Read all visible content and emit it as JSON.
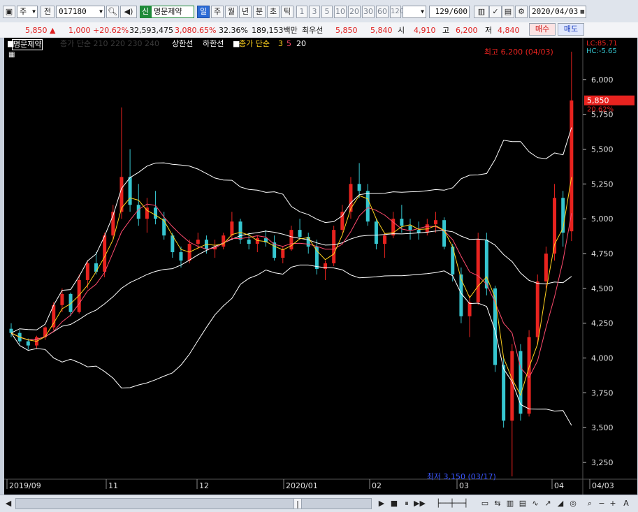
{
  "toolbar": {
    "period_select": "주",
    "prev_label": "전",
    "stock_code": "017180",
    "stock_badge": "신",
    "stock_name": "명문제약",
    "periods": [
      "일",
      "주",
      "월",
      "년",
      "분",
      "초",
      "틱"
    ],
    "active_period": "일",
    "interval_buttons": [
      "1",
      "3",
      "5",
      "10",
      "20",
      "30",
      "60",
      "120"
    ],
    "count_value": "129",
    "count_total": "/600",
    "date_value": "2020/04/03"
  },
  "quote": {
    "price": "5,850",
    "change_arrow": "▲",
    "change": "1,000",
    "change_pct": "+20.62%",
    "volume": "32,593,475",
    "volume_ratio": "3,080.65%",
    "turnover": "32.36%",
    "amount": "189,153백만",
    "best_ask_label": "최우선",
    "best_ask": "5,850",
    "best_bid": "5,840",
    "open_label": "시",
    "open": "4,910",
    "high_label": "고",
    "high": "6,200",
    "low_label": "저",
    "low": "4,840",
    "buy_label": "매수",
    "sell_label": "매도"
  },
  "chart_legend": {
    "name": "명문제약",
    "dim_text": "종가 단순 210 220 230 240",
    "upper_limit": "상한선",
    "lower_limit": "하한선",
    "ma_label": "종가 단순",
    "ma3": "3",
    "ma5": "5",
    "ma20": "20",
    "lc": "LC:85.71",
    "hc": "HC:-5.65"
  },
  "annotations": {
    "high_note": "최고 6,200 (04/03)",
    "low_note": "최저 3,150 (03/17)",
    "last_price": "5,850",
    "last_pct": "20.62%"
  },
  "colors": {
    "up": "#e8231f",
    "down": "#36c6d0",
    "ma3": "#ffd21f",
    "ma5": "#ff4b6e",
    "band": "#ffffff",
    "accent": "#2c6bd6"
  },
  "chart_data": {
    "type": "candlestick",
    "y_ticks": [
      "6,000",
      "5,750",
      "5,500",
      "5,250",
      "5,000",
      "4,750",
      "4,500",
      "4,250",
      "4,000",
      "3,750",
      "3,500",
      "3,250"
    ],
    "x_labels": [
      "2019/09",
      "11",
      "12",
      "2020/01",
      "02",
      "03",
      "04",
      "04/03"
    ],
    "ylim": [
      3150,
      6250
    ],
    "candles": [
      [
        4210,
        4250,
        4150,
        4180
      ],
      [
        4180,
        4200,
        4100,
        4120
      ],
      [
        4120,
        4140,
        4060,
        4090
      ],
      [
        4090,
        4160,
        4070,
        4150
      ],
      [
        4150,
        4230,
        4130,
        4220
      ],
      [
        4220,
        4400,
        4200,
        4380
      ],
      [
        4380,
        4500,
        4330,
        4460
      ],
      [
        4460,
        4470,
        4300,
        4330
      ],
      [
        4330,
        4600,
        4320,
        4560
      ],
      [
        4560,
        4700,
        4500,
        4680
      ],
      [
        4680,
        4760,
        4600,
        4620
      ],
      [
        4620,
        4900,
        4580,
        4880
      ],
      [
        4880,
        5100,
        4850,
        5050
      ],
      [
        5050,
        5800,
        5000,
        5300
      ],
      [
        5300,
        5500,
        5050,
        5100
      ],
      [
        5100,
        5250,
        4950,
        5000
      ],
      [
        5000,
        5150,
        4900,
        5080
      ],
      [
        5080,
        5200,
        4960,
        5000
      ],
      [
        5000,
        5050,
        4850,
        4880
      ],
      [
        4880,
        4900,
        4720,
        4760
      ],
      [
        4760,
        4800,
        4650,
        4700
      ],
      [
        4700,
        4850,
        4680,
        4820
      ],
      [
        4820,
        4900,
        4780,
        4850
      ],
      [
        4850,
        4880,
        4750,
        4780
      ],
      [
        4780,
        4850,
        4720,
        4800
      ],
      [
        4800,
        4900,
        4780,
        4880
      ],
      [
        4880,
        5050,
        4850,
        4980
      ],
      [
        4980,
        5000,
        4820,
        4850
      ],
      [
        4850,
        4900,
        4780,
        4820
      ],
      [
        4820,
        4880,
        4760,
        4860
      ],
      [
        4860,
        4920,
        4800,
        4830
      ],
      [
        4830,
        4880,
        4700,
        4720
      ],
      [
        4720,
        4800,
        4680,
        4780
      ],
      [
        4780,
        4950,
        4770,
        4920
      ],
      [
        4920,
        5000,
        4850,
        4870
      ],
      [
        4870,
        4900,
        4750,
        4800
      ],
      [
        4800,
        4850,
        4600,
        4640
      ],
      [
        4640,
        4700,
        4560,
        4680
      ],
      [
        4680,
        4950,
        4660,
        4920
      ],
      [
        4920,
        5100,
        4900,
        5050
      ],
      [
        5050,
        5300,
        5000,
        5250
      ],
      [
        5250,
        5400,
        5150,
        5200
      ],
      [
        5200,
        5250,
        4950,
        4980
      ],
      [
        4980,
        5000,
        4780,
        4820
      ],
      [
        4820,
        4900,
        4720,
        4880
      ],
      [
        4880,
        5050,
        4860,
        5000
      ],
      [
        5000,
        5100,
        4900,
        4950
      ],
      [
        4950,
        5000,
        4850,
        4920
      ],
      [
        4920,
        4980,
        4850,
        4900
      ],
      [
        4900,
        5000,
        4880,
        4960
      ],
      [
        4960,
        5050,
        4900,
        4990
      ],
      [
        4990,
        5010,
        4780,
        4800
      ],
      [
        4800,
        4820,
        4550,
        4600
      ],
      [
        4600,
        4650,
        4250,
        4300
      ],
      [
        4300,
        4450,
        4150,
        4400
      ],
      [
        4400,
        4900,
        4380,
        4850
      ],
      [
        4850,
        4900,
        4450,
        4500
      ],
      [
        4500,
        4520,
        3900,
        3950
      ],
      [
        3950,
        4000,
        3500,
        3550
      ],
      [
        3550,
        4100,
        3150,
        4050
      ],
      [
        4050,
        4100,
        3550,
        3600
      ],
      [
        3600,
        4200,
        3580,
        4150
      ],
      [
        4150,
        4600,
        4100,
        4550
      ],
      [
        4550,
        4800,
        4500,
        4750
      ],
      [
        4750,
        5250,
        4700,
        5150
      ],
      [
        5150,
        5200,
        4800,
        4900
      ],
      [
        4910,
        6200,
        4840,
        5850
      ]
    ]
  }
}
